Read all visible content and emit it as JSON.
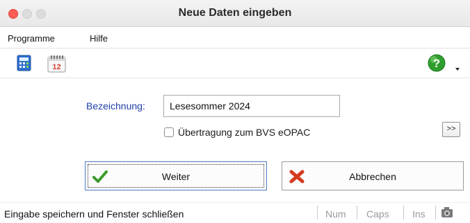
{
  "window": {
    "title": "Neue Daten eingeben"
  },
  "menu": {
    "items": [
      {
        "label": "Programme"
      },
      {
        "label": "Hilfe"
      }
    ]
  },
  "toolbar": {
    "buttons": [
      {
        "icon": "calculator-icon"
      },
      {
        "icon": "calendar-icon"
      }
    ],
    "help": {
      "icon": "help-icon",
      "dropdown_icon": "chevron-down-icon"
    }
  },
  "form": {
    "bezeichnung_label": "Bezeichnung:",
    "bezeichnung_value": "Lesesommer 2024",
    "checkbox_label": "Übertragung zum BVS eOPAC",
    "checkbox_checked": false,
    "more_button_label": ">>"
  },
  "buttons": {
    "weiter_label": "Weiter",
    "abbrechen_label": "Abbrechen"
  },
  "status": {
    "text": "Eingabe speichern und Fenster schließen",
    "indicators": [
      "Num",
      "Caps",
      "Ins"
    ]
  },
  "colors": {
    "close": "#ff5f57",
    "label_blue": "#1f3fa8",
    "check_green": "#3a9b2a",
    "cross_red": "#d63a1e",
    "help_green": "#2f9e2f"
  }
}
